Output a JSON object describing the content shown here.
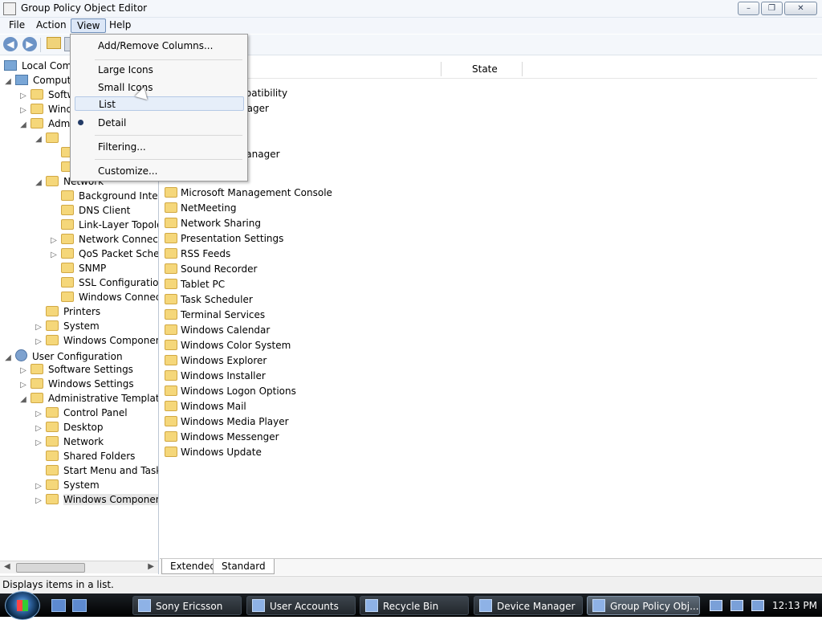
{
  "window": {
    "title": "Group Policy Object Editor",
    "controls": [
      "–",
      "❐",
      "✕"
    ]
  },
  "menubar": {
    "items": [
      "File",
      "Action",
      "View",
      "Help"
    ]
  },
  "view_menu": {
    "items": [
      "Add/Remove Columns...",
      "Large Icons",
      "Small Icons",
      "List",
      "Detail",
      "Filtering...",
      "Customize..."
    ],
    "selected": "Detail",
    "hovered": "List"
  },
  "left_tree": {
    "root": "Local Comp",
    "items": [
      {
        "label": "Comput",
        "level": 1,
        "expanded": true,
        "icon": "computer-icon"
      },
      {
        "label": "Softw",
        "level": 2,
        "expanded": false,
        "icon": "folder-icon"
      },
      {
        "label": "Wind",
        "level": 2,
        "expanded": false,
        "icon": "folder-icon"
      },
      {
        "label": "Adm",
        "level": 2,
        "expanded": true,
        "icon": "folder-icon"
      },
      {
        "label": "",
        "level": 3,
        "expanded": true,
        "icon": "folder-icon"
      },
      {
        "label": "",
        "level": 4,
        "expanded": null,
        "icon": "folder-icon"
      },
      {
        "label": "",
        "level": 4,
        "expanded": null,
        "icon": "folder-icon"
      },
      {
        "label": "Network",
        "level": 3,
        "expanded": true,
        "icon": "folder-icon"
      },
      {
        "label": "Background Intell",
        "level": 4,
        "expanded": null,
        "icon": "folder-icon"
      },
      {
        "label": "DNS Client",
        "level": 4,
        "expanded": null,
        "icon": "folder-icon"
      },
      {
        "label": "Link-Layer Topolo",
        "level": 4,
        "expanded": null,
        "icon": "folder-icon"
      },
      {
        "label": "Network Connect",
        "level": 4,
        "expanded": false,
        "icon": "folder-icon"
      },
      {
        "label": "QoS Packet Schec",
        "level": 4,
        "expanded": false,
        "icon": "folder-icon"
      },
      {
        "label": "SNMP",
        "level": 4,
        "expanded": null,
        "icon": "folder-icon"
      },
      {
        "label": "SSL Configuratio",
        "level": 4,
        "expanded": null,
        "icon": "folder-icon"
      },
      {
        "label": "Windows Connec",
        "level": 4,
        "expanded": null,
        "icon": "folder-icon"
      },
      {
        "label": "Printers",
        "level": 3,
        "expanded": null,
        "icon": "folder-icon"
      },
      {
        "label": "System",
        "level": 3,
        "expanded": false,
        "icon": "folder-icon"
      },
      {
        "label": "Windows Componen",
        "level": 3,
        "expanded": false,
        "icon": "folder-icon"
      },
      {
        "label": "User Configuration",
        "level": 1,
        "expanded": true,
        "icon": "user-icon"
      },
      {
        "label": "Software Settings",
        "level": 2,
        "expanded": false,
        "icon": "folder-icon"
      },
      {
        "label": "Windows Settings",
        "level": 2,
        "expanded": false,
        "icon": "folder-icon"
      },
      {
        "label": "Administrative Template",
        "level": 2,
        "expanded": true,
        "icon": "folder-icon"
      },
      {
        "label": "Control Panel",
        "level": 3,
        "expanded": false,
        "icon": "folder-icon"
      },
      {
        "label": "Desktop",
        "level": 3,
        "expanded": false,
        "icon": "folder-icon"
      },
      {
        "label": "Network",
        "level": 3,
        "expanded": false,
        "icon": "folder-icon"
      },
      {
        "label": "Shared Folders",
        "level": 3,
        "expanded": null,
        "icon": "folder-icon"
      },
      {
        "label": "Start Menu and Taskb",
        "level": 3,
        "expanded": null,
        "icon": "folder-icon"
      },
      {
        "label": "System",
        "level": 3,
        "expanded": false,
        "icon": "folder-icon"
      },
      {
        "label": "Windows Componen",
        "level": 3,
        "expanded": false,
        "icon": "folder-icon",
        "selected": true
      }
    ]
  },
  "right_panel": {
    "columns": [
      "State"
    ],
    "partial_items": [
      "npatibility",
      "nager",
      "s",
      "v Manager"
    ],
    "items": [
      "Microsoft Management Console",
      "NetMeeting",
      "Network Sharing",
      "Presentation Settings",
      "RSS Feeds",
      "Sound Recorder",
      "Tablet PC",
      "Task Scheduler",
      "Terminal Services",
      "Windows Calendar",
      "Windows Color System",
      "Windows Explorer",
      "Windows Installer",
      "Windows Logon Options",
      "Windows Mail",
      "Windows Media Player",
      "Windows Messenger",
      "Windows Update"
    ],
    "tabs": [
      "Extended",
      "Standard"
    ]
  },
  "statusbar": {
    "text": "Displays items in a list."
  },
  "taskbar": {
    "buttons": [
      "Sony Ericsson",
      "User Accounts",
      "Recycle Bin",
      "Device Manager",
      "Group Policy Obj..."
    ],
    "active": "Group Policy Obj...",
    "clock": "12:13 PM"
  },
  "colors": {
    "selection_blue": "#dce7f7",
    "taskbar_dark": "#1a1f24",
    "folder_yellow": "#f5d77a"
  }
}
